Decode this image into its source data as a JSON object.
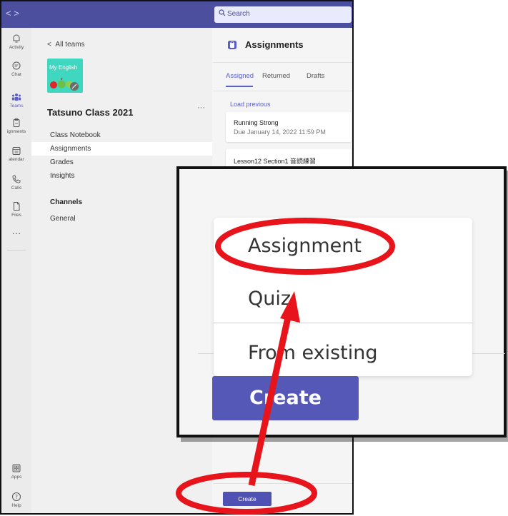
{
  "topbar": {
    "search_placeholder": "Search"
  },
  "rail": {
    "items": [
      {
        "label": "Activity"
      },
      {
        "label": "Chat"
      },
      {
        "label": "Teams"
      },
      {
        "label": "ignments"
      },
      {
        "label": "alendar"
      },
      {
        "label": "Calls"
      },
      {
        "label": "Files"
      },
      {
        "label": "Apps"
      },
      {
        "label": "Help"
      }
    ],
    "more": "···"
  },
  "teams_panel": {
    "back_label": "All teams",
    "avatar_text": "My English",
    "team_name": "Tatsuno Class 2021",
    "more": "···",
    "nav": [
      {
        "label": "Class Notebook"
      },
      {
        "label": "Assignments"
      },
      {
        "label": "Grades"
      },
      {
        "label": "Insights"
      }
    ],
    "channels_title": "Channels",
    "channels": [
      {
        "label": "General"
      }
    ]
  },
  "assignments": {
    "title": "Assignments",
    "tabs": [
      {
        "label": "Assigned"
      },
      {
        "label": "Returned"
      },
      {
        "label": "Drafts"
      }
    ],
    "load_previous": "Load previous",
    "cards": [
      {
        "title": "Running Strong",
        "due": "Due January 14, 2022 11:59 PM"
      },
      {
        "title": "Lesson12 Section1 音読練習",
        "due": ""
      }
    ],
    "create_label": "Create"
  },
  "callout": {
    "menu_items": [
      {
        "label": "Assignment"
      },
      {
        "label": "Quiz"
      },
      {
        "label": "From existing"
      }
    ],
    "create_label": "Create"
  },
  "colors": {
    "brand": "#4b4f9e",
    "accent": "#5b5fc7",
    "button": "#5558b6",
    "annotation": "#e8141b"
  }
}
